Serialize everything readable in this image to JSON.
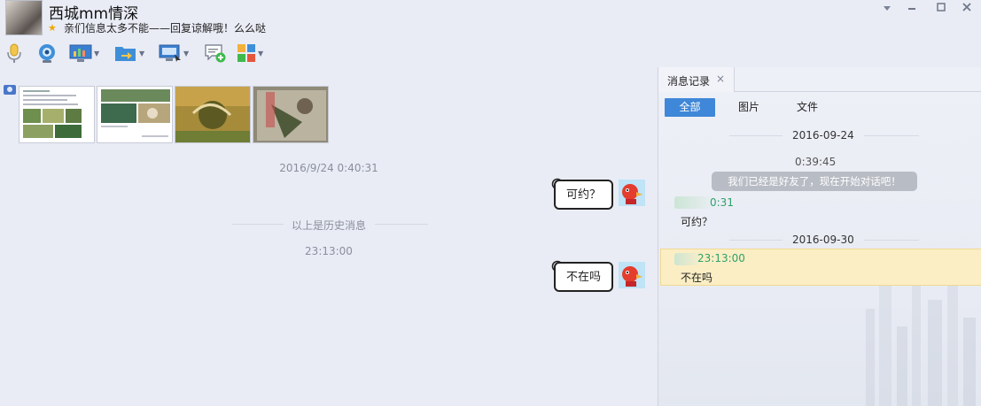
{
  "header": {
    "contact_name": "西城mm情深",
    "signature": "亲们信息太多不能——回复谅解哦！么么哒",
    "star_icon": "star-icon"
  },
  "window_controls": [
    "chevron-down-icon",
    "minimize-icon",
    "maximize-icon",
    "close-icon"
  ],
  "toolbar": [
    {
      "name": "voice-call-button",
      "icon": "microphone-icon"
    },
    {
      "name": "video-call-button",
      "icon": "camera-icon"
    },
    {
      "name": "app-button",
      "icon": "monitor-chart-icon",
      "dropdown": true
    },
    {
      "name": "send-file-button",
      "icon": "folder-arrow-icon",
      "dropdown": true
    },
    {
      "name": "remote-desktop-button",
      "icon": "screen-icon",
      "dropdown": true
    },
    {
      "name": "new-message-button",
      "icon": "chat-plus-icon"
    },
    {
      "name": "apps-button",
      "icon": "tiles-icon",
      "dropdown": true
    }
  ],
  "chat": {
    "timestamp1": "2016/9/24 0:40:31",
    "history_label": "以上是历史消息",
    "timestamp2": "23:13:00",
    "messages": [
      {
        "text": "可约？"
      },
      {
        "text": "不在吗"
      }
    ]
  },
  "history_panel": {
    "tab_label": "消息记录",
    "close_symbol": "×",
    "filters": {
      "all": "全部",
      "images": "图片",
      "files": "文件"
    },
    "date1": "2016-09-24",
    "time1": "0:39:45",
    "system_message": "我们已经是好友了，现在开始对话吧！",
    "msg1_time": "0:31",
    "msg1_text": "可约？",
    "date2": "2016-09-30",
    "msg2_time": "23:13:00",
    "msg2_text": "不在吗"
  },
  "colors": {
    "background": "#e9ecf5",
    "accent_blue": "#3f87d8",
    "highlight_row": "#fbeec4",
    "sender_time_green": "#2ea16b"
  }
}
